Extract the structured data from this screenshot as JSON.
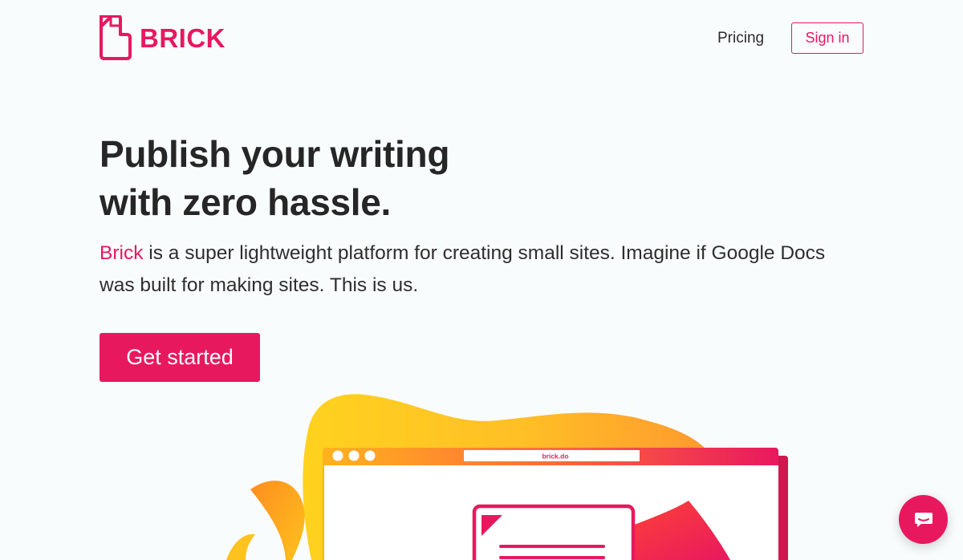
{
  "colors": {
    "brand": "#e8185f",
    "text": "#262626",
    "background": "#f9fcfd"
  },
  "header": {
    "logo_text": "BRICK",
    "logo_icon": "brick-logo-icon",
    "nav": {
      "pricing_label": "Pricing",
      "signin_label": "Sign in"
    }
  },
  "hero": {
    "headline_line1": "Publish your writing",
    "headline_line2": "with zero hassle.",
    "lead_brand": "Brick",
    "lead_text": " is a super lightweight platform for creating small sites. Imagine if Google Docs was built for making sites. This is us.",
    "cta_label": "Get started"
  },
  "illustration": {
    "browser_url": "brick.do"
  },
  "chat": {
    "icon": "chat-icon"
  }
}
